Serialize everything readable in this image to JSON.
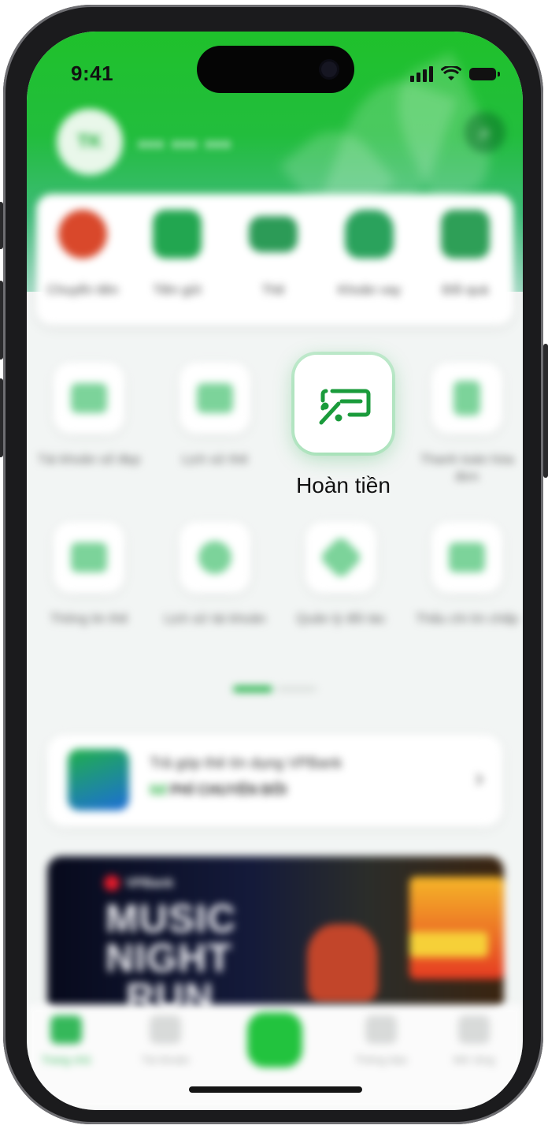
{
  "status_bar": {
    "time": "9:41"
  },
  "header": {
    "avatar_initials": "TK",
    "account_masked": "••• ••• •••"
  },
  "quick_actions": [
    {
      "label": "Chuyển tiền",
      "icon": "transfer-coin-icon",
      "color": "#d9482b"
    },
    {
      "label": "Tiền gửi",
      "icon": "piggy-bank-icon",
      "color": "#22a650"
    },
    {
      "label": "Thẻ",
      "icon": "card-icon",
      "color": "#2c9b57"
    },
    {
      "label": "Khoản vay",
      "icon": "money-bag-icon",
      "color": "#2aa25c"
    },
    {
      "label": "Đổi quà",
      "icon": "gift-icon",
      "color": "#2e9f57"
    }
  ],
  "services": {
    "row1": [
      {
        "label": "Tài khoản số đẹp",
        "icon": "vanity-number-icon"
      },
      {
        "label": "Lịch sử thẻ",
        "icon": "card-history-icon"
      },
      {
        "label": "Hoàn tiền",
        "icon": "cashback-icon"
      },
      {
        "label": "Thanh toán hóa đơn",
        "icon": "bill-payment-icon"
      }
    ],
    "row2": [
      {
        "label": "Thông tin thẻ",
        "icon": "card-info-icon"
      },
      {
        "label": "Lịch sử tài khoản",
        "icon": "clock-icon"
      },
      {
        "label": "Quản lý đối tác",
        "icon": "partner-icon"
      },
      {
        "label": "Thấu chi tín chấp",
        "icon": "overdraft-icon"
      }
    ],
    "highlight_color": "#1a9b3b"
  },
  "promo": {
    "line1": "Trả góp thẻ tín dụng VPBank",
    "line2_accent": "0đ",
    "line2_rest": "PHÍ CHUYỂN ĐỔI"
  },
  "banner": {
    "brand": "VPBank",
    "line1": "MUSIC",
    "line2": "NIGHT",
    "line3": "RUN"
  },
  "tab_bar": [
    {
      "label": "Trang chủ",
      "icon": "home-icon",
      "active": true
    },
    {
      "label": "Tài khoản",
      "icon": "account-icon",
      "active": false
    },
    {
      "label": "",
      "icon": "center-wallet-icon",
      "active": false
    },
    {
      "label": "Thông báo",
      "icon": "bell-icon",
      "active": false
    },
    {
      "label": "Mở rộng",
      "icon": "menu-icon",
      "active": false
    }
  ],
  "colors": {
    "brand_green": "#1fc12b",
    "accent_green": "#24b24a"
  }
}
